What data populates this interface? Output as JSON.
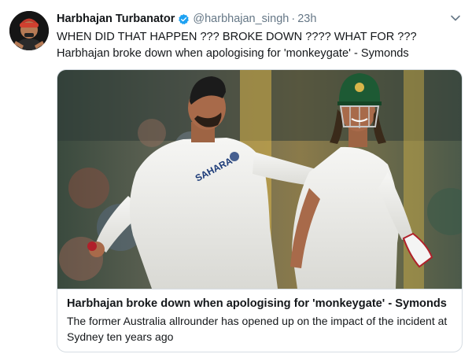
{
  "author": {
    "display_name": "Harbhajan Turbanator",
    "handle": "@harbhajan_singh",
    "separator": "·",
    "timestamp": "23h",
    "avatar_icon": "profile-avatar",
    "verified_icon": "verified-badge-icon"
  },
  "tweet": {
    "text": "WHEN DID THAT HAPPEN ??? BROKE DOWN ???? WHAT FOR ??? Harbhajan broke down when apologising for 'monkeygate' - Symonds"
  },
  "card": {
    "image_icon": "cricket-players-photo",
    "jersey_text": "SAHARA",
    "title": "Harbhajan broke down when apologising for 'monkeygate' - Symonds",
    "description": "The former Australia allrounder has opened up on the impact of the incident at Sydney ten years ago"
  },
  "colors": {
    "verified_blue": "#1da1f2",
    "muted_text": "#657786",
    "border": "#d6dde3"
  }
}
